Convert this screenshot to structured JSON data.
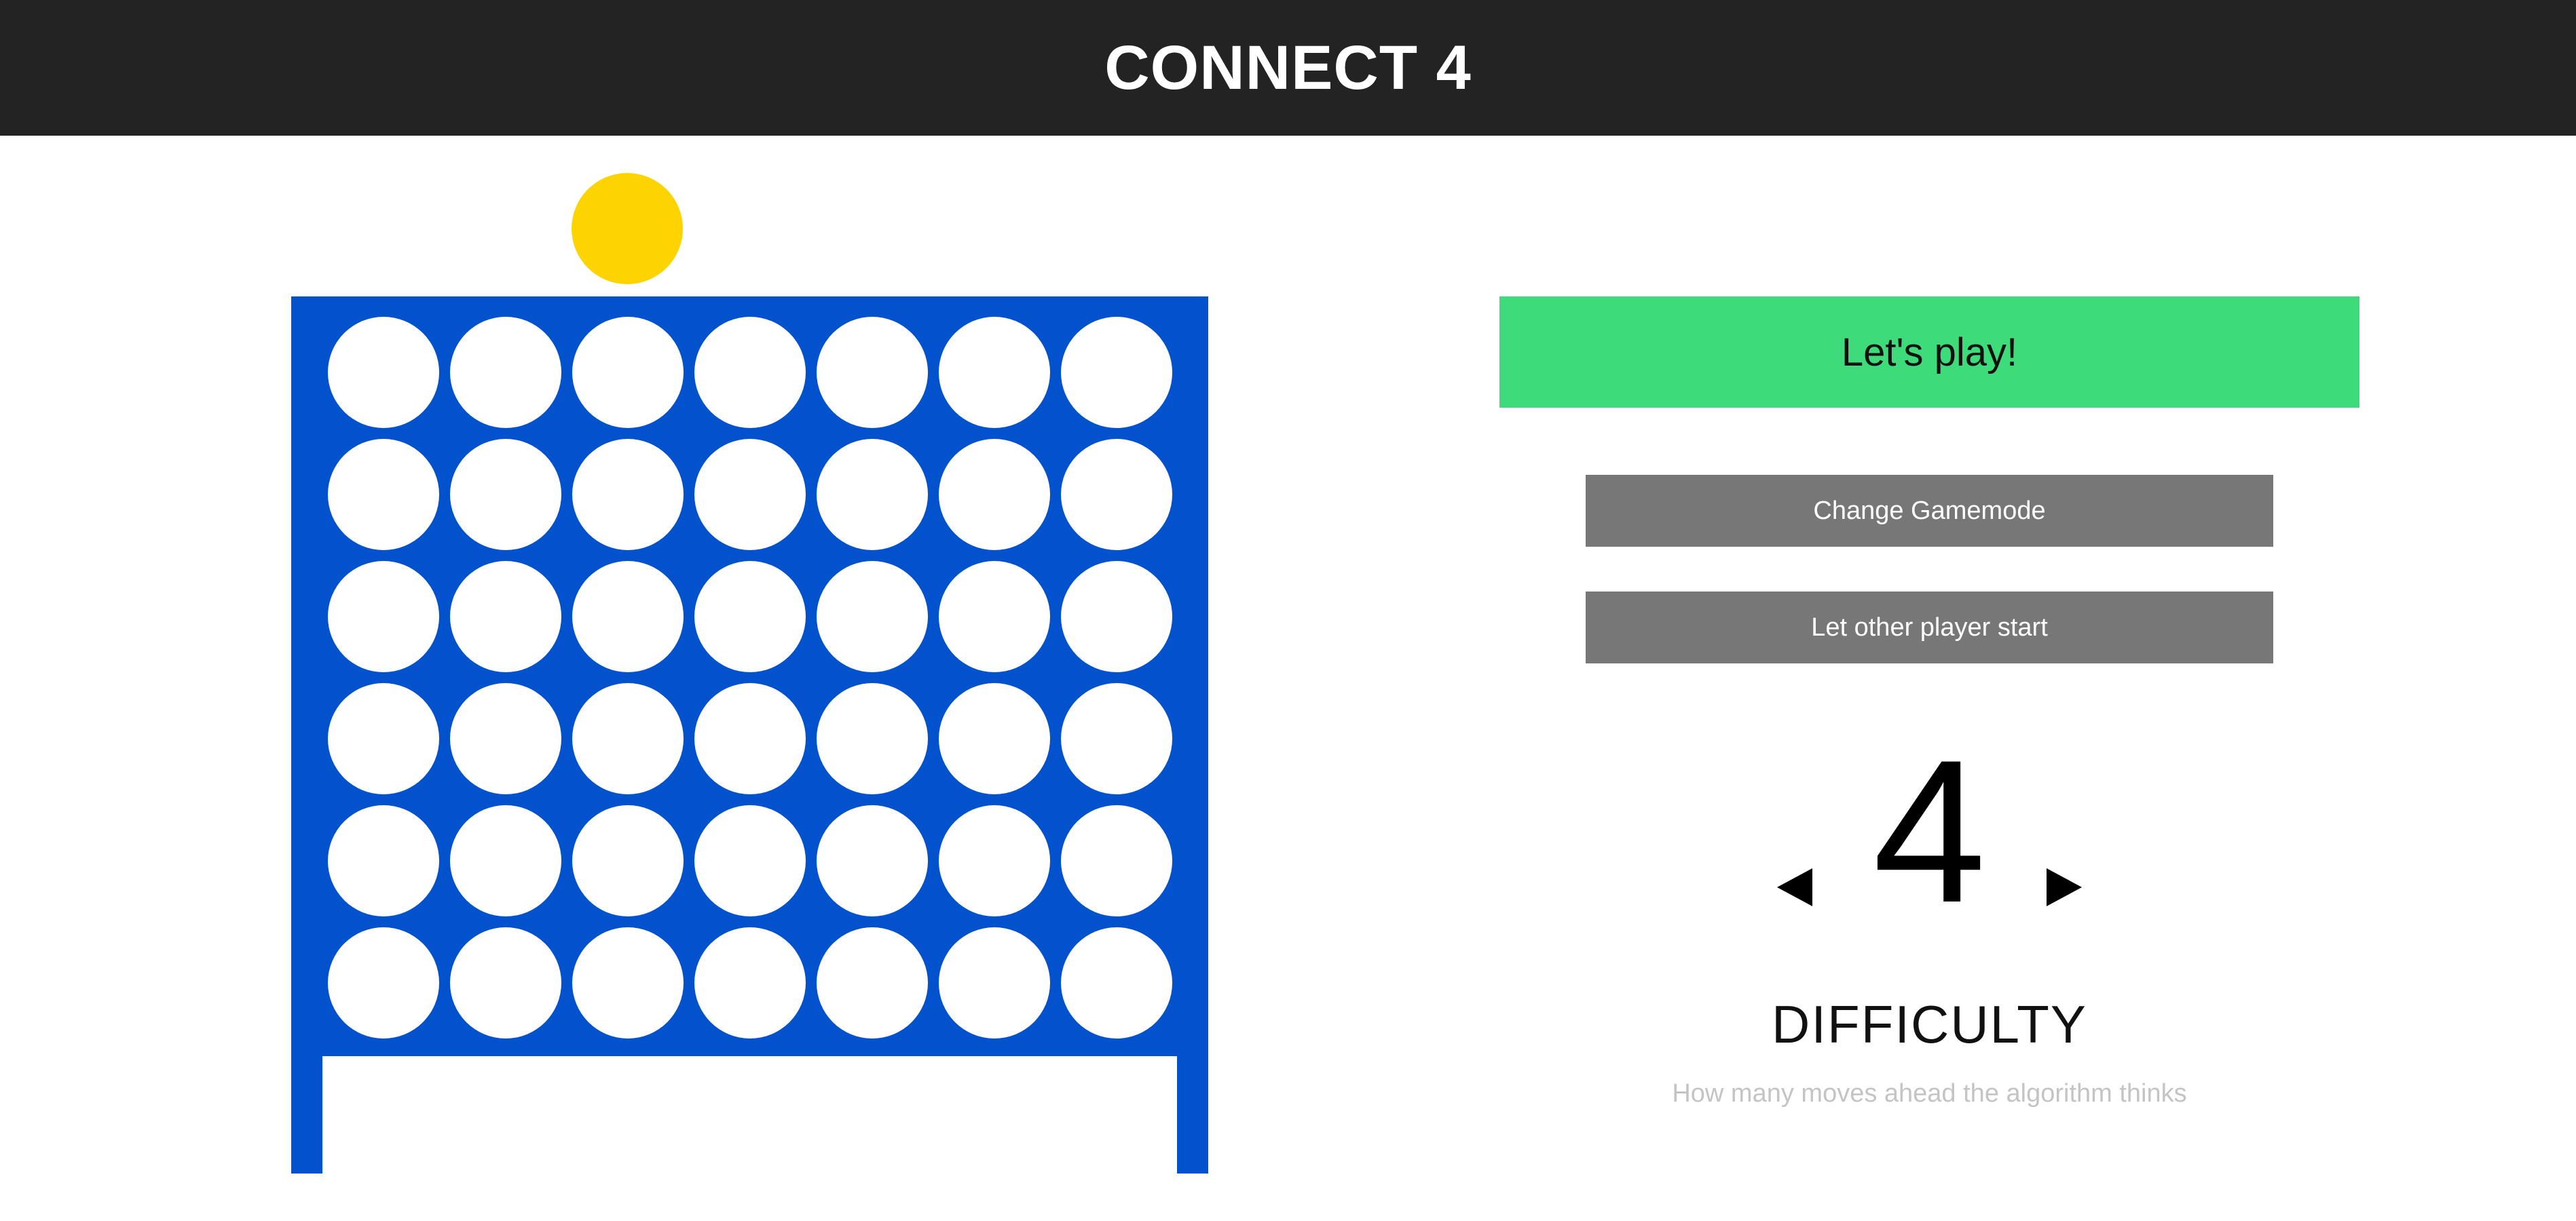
{
  "header": {
    "title": "CONNECT 4"
  },
  "game": {
    "current_disc_color": "#fed400",
    "board_color": "#0251cd",
    "columns": 7,
    "rows": 6,
    "cells": [
      [
        "empty",
        "empty",
        "empty",
        "empty",
        "empty",
        "empty",
        "empty"
      ],
      [
        "empty",
        "empty",
        "empty",
        "empty",
        "empty",
        "empty",
        "empty"
      ],
      [
        "empty",
        "empty",
        "empty",
        "empty",
        "empty",
        "empty",
        "empty"
      ],
      [
        "empty",
        "empty",
        "empty",
        "empty",
        "empty",
        "empty",
        "empty"
      ],
      [
        "empty",
        "empty",
        "empty",
        "empty",
        "empty",
        "empty",
        "empty"
      ],
      [
        "empty",
        "empty",
        "empty",
        "empty",
        "empty",
        "empty",
        "empty"
      ]
    ]
  },
  "controls": {
    "play_label": "Let's play!",
    "play_color": "#3ddb79",
    "gamemode_label": "Change Gamemode",
    "starter_label": "Let other player start",
    "secondary_button_color": "#777777"
  },
  "difficulty": {
    "value": "4",
    "label": "DIFFICULTY",
    "hint": "How many moves ahead the algorithm thinks",
    "decrease_icon": "triangle-left-icon",
    "increase_icon": "triangle-right-icon"
  }
}
